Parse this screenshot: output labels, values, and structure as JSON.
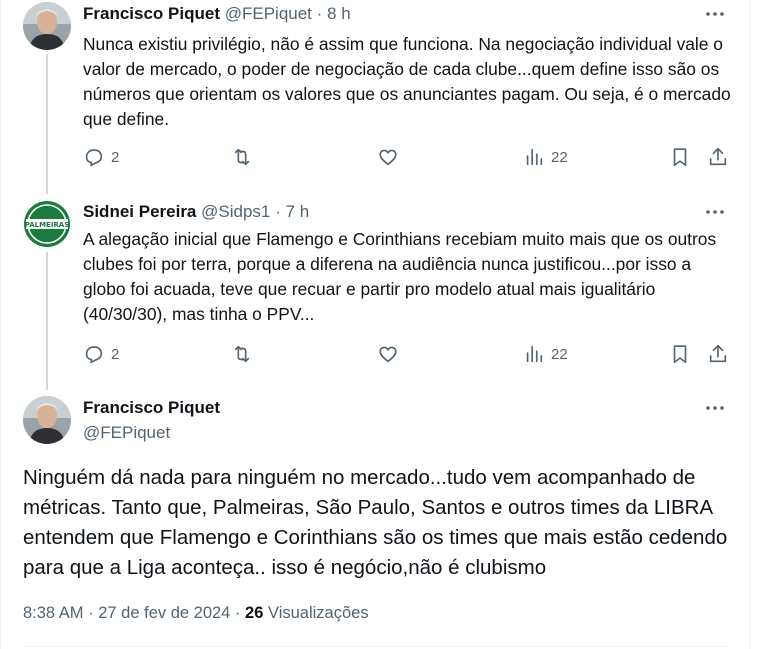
{
  "reply1": {
    "name": "Francisco Piquet",
    "handle": "@FEPiquet",
    "separator": "·",
    "time": "8 h",
    "text": "Nunca existiu privilégio, não é assim que funciona. Na negociação individual vale o valor de mercado, o poder de negociação de cada clube...quem define isso são os números que orientam os valores que os anunciantes pagam. Ou seja, é o mercado que define.",
    "replies": "2",
    "views": "22"
  },
  "reply2": {
    "name": "Sidnei Pereira",
    "handle": "@Sidps1",
    "separator": "·",
    "time": "7 h",
    "avatar_text": "PALMEIRAS",
    "text": "A alegação inicial que Flamengo e Corinthians recebiam muito mais que os outros clubes foi por terra, porque a diferena na audiência nunca justificou...por isso a globo foi acuada, teve que recuar e partir pro modelo atual mais igualitário (40/30/30), mas tinha o PPV...",
    "replies": "2",
    "views": "22"
  },
  "main": {
    "name": "Francisco Piquet",
    "handle": "@FEPiquet",
    "text": "Ninguém dá nada para ninguém no mercado...tudo vem acompanhado de métricas. Tanto que, Palmeiras, São Paulo, Santos e outros times da LIBRA entendem que Flamengo e Corinthians são os times que mais estão cedendo para que a Liga aconteça.. isso é negócio,não é clubismo",
    "time": "8:38 AM",
    "date": "27 de fev de 2024",
    "separator": "·",
    "views_count": "26",
    "views_label": "Visualizações"
  },
  "icons": {
    "reply": "reply-icon",
    "retweet": "retweet-icon",
    "like": "like-icon",
    "views": "views-icon",
    "bookmark": "bookmark-icon",
    "share": "share-icon",
    "more": "more-icon"
  },
  "colors": {
    "text": "#0f1419",
    "secondary": "#536471",
    "thread_line": "#cfd9de",
    "palmeiras_green": "#1b7a3e"
  }
}
